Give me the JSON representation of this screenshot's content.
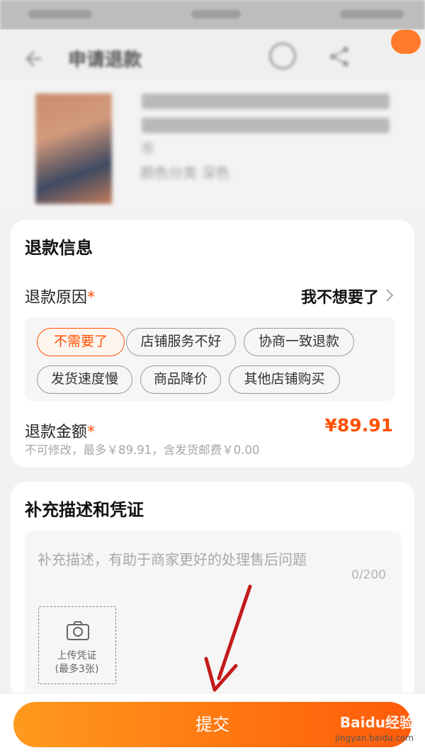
{
  "header": {
    "title": "申请退款"
  },
  "product": {
    "price_fragment": "币",
    "variant_label": "颜色分类",
    "variant_value": "深色"
  },
  "refund": {
    "section_title": "退款信息",
    "reason_label": "退款原因",
    "required_mark": "*",
    "reason_value": "我不想要了",
    "reason_options": [
      {
        "label": "不需要了",
        "selected": true
      },
      {
        "label": "店铺服务不好",
        "selected": false
      },
      {
        "label": "协商一致退款",
        "selected": false
      },
      {
        "label": "发货速度慢",
        "selected": false
      },
      {
        "label": "商品降价",
        "selected": false
      },
      {
        "label": "其他店铺购买",
        "selected": false
      }
    ],
    "amount_label": "退款金额",
    "amount_value": "¥89.91",
    "amount_note": "不可修改，最多￥89.91，含发货邮费￥0.00"
  },
  "description": {
    "section_title": "补充描述和凭证",
    "placeholder": "补充描述，有助于商家更好的处理售后问题",
    "char_count": "0/200",
    "upload_label": "上传凭证",
    "upload_limit": "(最多3张)"
  },
  "footer": {
    "submit_label": "提交"
  },
  "watermark": {
    "logo": "Baidu经验",
    "url": "jingyan.baidu.com"
  },
  "colors": {
    "accent": "#ff5000",
    "button_start": "#ff9a1e",
    "button_end": "#ff5b0a"
  }
}
